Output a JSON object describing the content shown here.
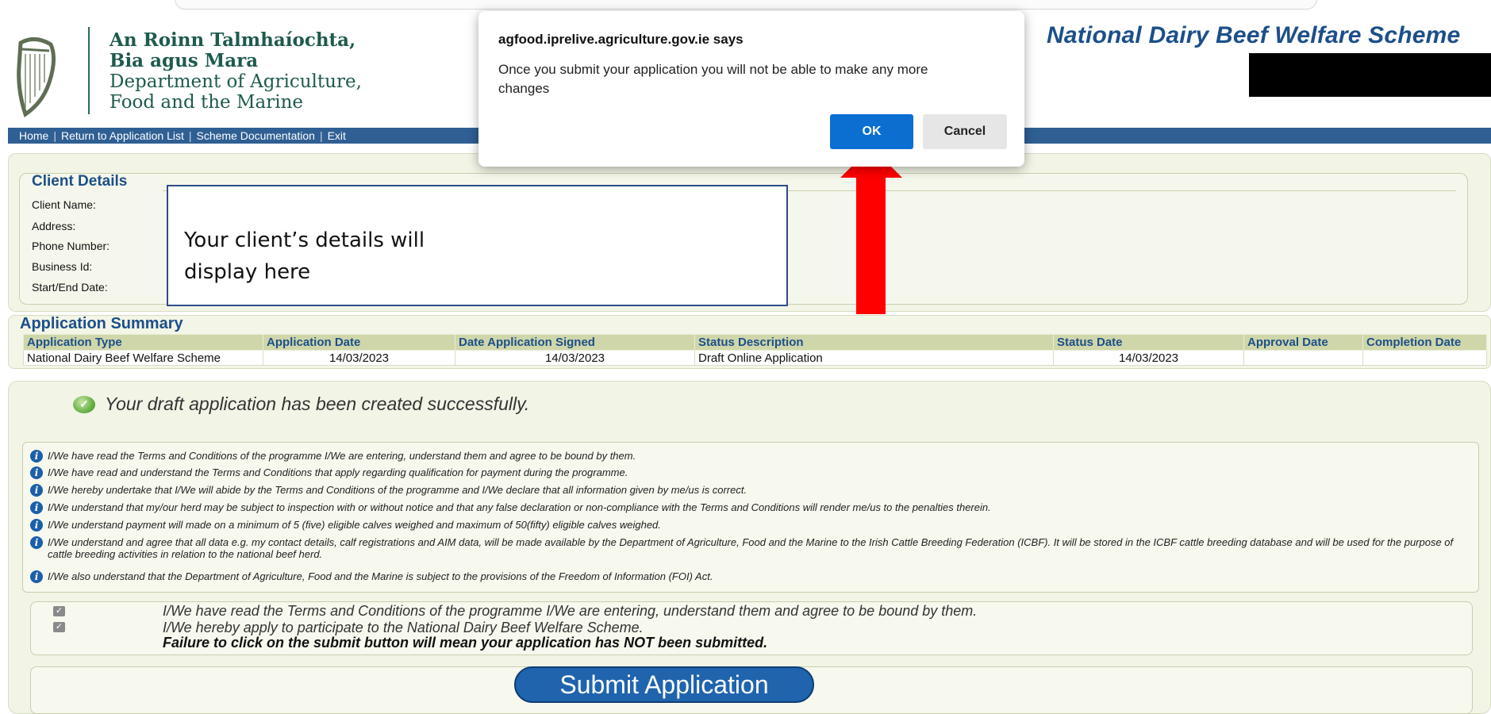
{
  "header": {
    "dept_lines": [
      "An Roinn Talmhaíochta,",
      "Bia agus Mara",
      "Department of Agriculture,",
      "Food and the Marine"
    ],
    "scheme_title": "National Dairy Beef Welfare Scheme",
    "logo_icon": "harp-icon"
  },
  "nav": {
    "items": [
      "Home",
      "Return to Application List",
      "Scheme Documentation",
      "Exit"
    ]
  },
  "client_details": {
    "title": "Client Details",
    "labels": [
      "Client Name:",
      "Address:",
      "Phone Number:",
      "Business Id:",
      "Start/End Date:"
    ],
    "callout": [
      "Your client’s details will",
      "display here"
    ]
  },
  "summary": {
    "title": "Application Summary",
    "columns": [
      "Application Type",
      "Application Date",
      "Date Application Signed",
      "Status Description",
      "Status Date",
      "Approval Date",
      "Completion Date"
    ],
    "row": [
      "National Dairy Beef Welfare Scheme",
      "14/03/2023",
      "14/03/2023",
      "Draft Online Application",
      "14/03/2023",
      "",
      ""
    ]
  },
  "success_message": "Your draft application has been created successfully.",
  "terms": [
    "I/We have read the Terms and Conditions of the programme I/We are entering, understand them and agree to be bound by them.",
    "I/We have read and understand the Terms and Conditions that apply regarding qualification for payment during the programme.",
    "I/We hereby undertake that I/We will abide by the Terms and Conditions of the programme and I/We declare that all information given by me/us is correct.",
    "I/We understand that my/our herd may be subject to inspection with or without notice and that any false declaration or non-compliance with the Terms and Conditions will render me/us to the penalties therein.",
    "I/We understand payment will made on a minimum of 5 (five) eligible calves weighed and maximum of 50(fifty) eligible calves weighed.",
    "I/We understand and agree that all data e.g. my contact details, calf registrations and AIM data, will be made available by the Department of Agriculture, Food and the Marine to the Irish Cattle Breeding Federation (ICBF). It will be stored in the ICBF cattle breeding database and will be used for the purpose of cattle breeding activities in relation to the national beef herd.",
    "I/We also understand that the Department of Agriculture, Food and the Marine is subject to the provisions of the Freedom of Information (FOI) Act."
  ],
  "agreements": {
    "checkbox_1": "I/We have read the Terms and Conditions of the programme I/We are entering, understand them and agree to be bound by them.",
    "checkbox_2": "I/We hereby apply to participate to the National Dairy Beef Welfare Scheme.",
    "warning": "Failure to click on the submit button will mean your application has NOT been submitted."
  },
  "submit_label": "Submit Application",
  "dialog": {
    "origin": "agfood.iprelive.agriculture.gov.ie says",
    "message": "Once you submit your application you will not be able to make any more changes",
    "ok_label": "OK",
    "cancel_label": "Cancel"
  },
  "colors": {
    "nav_bg": "#2f5f93",
    "title_blue": "#1c4f8a",
    "panel_bg": "#f2f4e6",
    "ok_button": "#0b6fd1",
    "arrow": "#ff0000"
  }
}
